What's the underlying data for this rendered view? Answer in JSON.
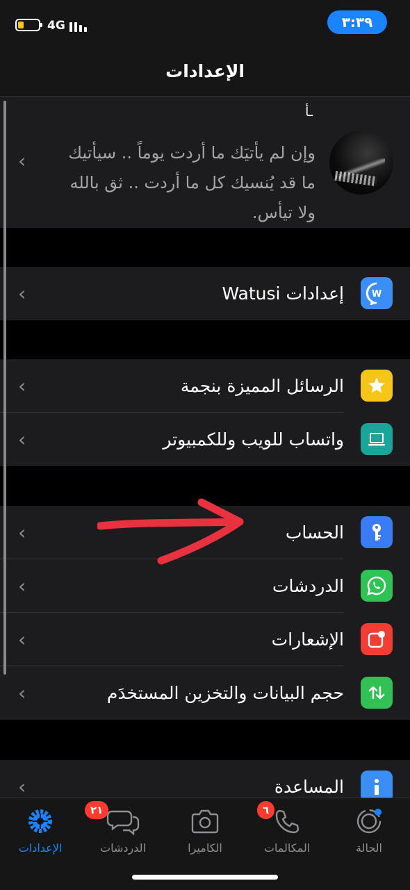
{
  "status_bar": {
    "network": "4G",
    "time": "٣:٣٩"
  },
  "nav": {
    "title": "الإعدادات"
  },
  "profile": {
    "name": "ـأ",
    "status_lines": [
      "وإن لم يأتيَك ما أردت يوماً ..  سيأتيك",
      "ما قد يُنسيك كل ما أردت ..  ثق بالله",
      "ولا تيأس."
    ]
  },
  "groups": {
    "watusi": [
      {
        "label": "إعدادات Watusi",
        "icon": "watusi-icon",
        "color": "#3a8ef6"
      }
    ],
    "starred": [
      {
        "label": "الرسائل المميزة بنجمة",
        "icon": "star-icon",
        "color": "#f5c518"
      },
      {
        "label": "واتساب للويب وللكمبيوتر",
        "icon": "laptop-icon",
        "color": "#1aa59a"
      }
    ],
    "main": [
      {
        "label": "الحساب",
        "icon": "key-icon",
        "color": "#3a7bf6"
      },
      {
        "label": "الدردشات",
        "icon": "whatsapp-icon",
        "color": "#2fc355"
      },
      {
        "label": "الإشعارات",
        "icon": "notification-icon",
        "color": "#f23d34"
      },
      {
        "label": "حجم البيانات والتخزين المستخدَم",
        "icon": "data-arrows-icon",
        "color": "#32c155"
      }
    ],
    "help": [
      {
        "label": "المساعدة",
        "icon": "info-icon",
        "color": "#3a8ef6"
      }
    ]
  },
  "tabs": [
    {
      "label": "الإعدادات",
      "icon": "settings-gear-icon",
      "active": true
    },
    {
      "label": "الدردشات",
      "icon": "chats-icon",
      "badge": "٢١"
    },
    {
      "label": "الكاميرا",
      "icon": "camera-icon"
    },
    {
      "label": "المكالمات",
      "icon": "phone-icon",
      "badge": "٦"
    },
    {
      "label": "الحالة",
      "icon": "status-ring-icon"
    }
  ],
  "colors": {
    "accent": "#1a84ff",
    "badge": "#ff3b30",
    "annotation_arrow": "#e8323f"
  }
}
